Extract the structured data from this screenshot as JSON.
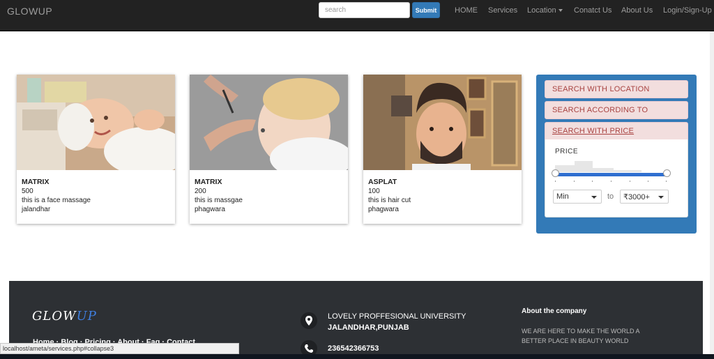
{
  "navbar": {
    "brand": "GLOWUP",
    "search_placeholder": "search",
    "submit_label": "Submit",
    "links": [
      "HOME",
      "Services",
      "Location",
      "Conatct Us",
      "About Us",
      "Login/Sign-Up"
    ]
  },
  "cards": [
    {
      "title": "MATRIX",
      "price": "500",
      "description": "this is a face massage",
      "location": "jalandhar"
    },
    {
      "title": "MATRIX",
      "price": "200",
      "description": "this is massgae",
      "location": "phagwara"
    },
    {
      "title": "ASPLAT",
      "price": "100",
      "description": "this is hair cut",
      "location": "phagwara"
    }
  ],
  "filter": {
    "items": [
      "SEARCH WITH LOCATION",
      "SEARCH ACCORDING TO",
      "SEARCH WITH PRICE"
    ],
    "price_label": "PRICE",
    "min_value": "Min",
    "to_label": "to",
    "max_value": "₹3000+",
    "range_fraction": [
      0,
      1
    ]
  },
  "footer": {
    "logo_main": "GLOW",
    "logo_accent": "UP",
    "links": "Home · Blog · Pricing · About · Faq · Contact",
    "address_line1": "LOVELY PROFFESIONAL UNIVERSITY",
    "address_line2": "JALANDHAR,PUNJAB",
    "phone": "236542366753",
    "about_heading": "About the company",
    "about_text": "WE ARE HERE TO MAKE THE WORLD A BETTER PLACE IN BEAUTY WORLD"
  },
  "status_url": "localhost/ameta/services.php#collapse3",
  "colors": {
    "navbar": "#222222",
    "primary": "#337ab7",
    "panel_heading": "#f2dede",
    "footer": "#2d3034",
    "accent": "#3f7fe0"
  }
}
